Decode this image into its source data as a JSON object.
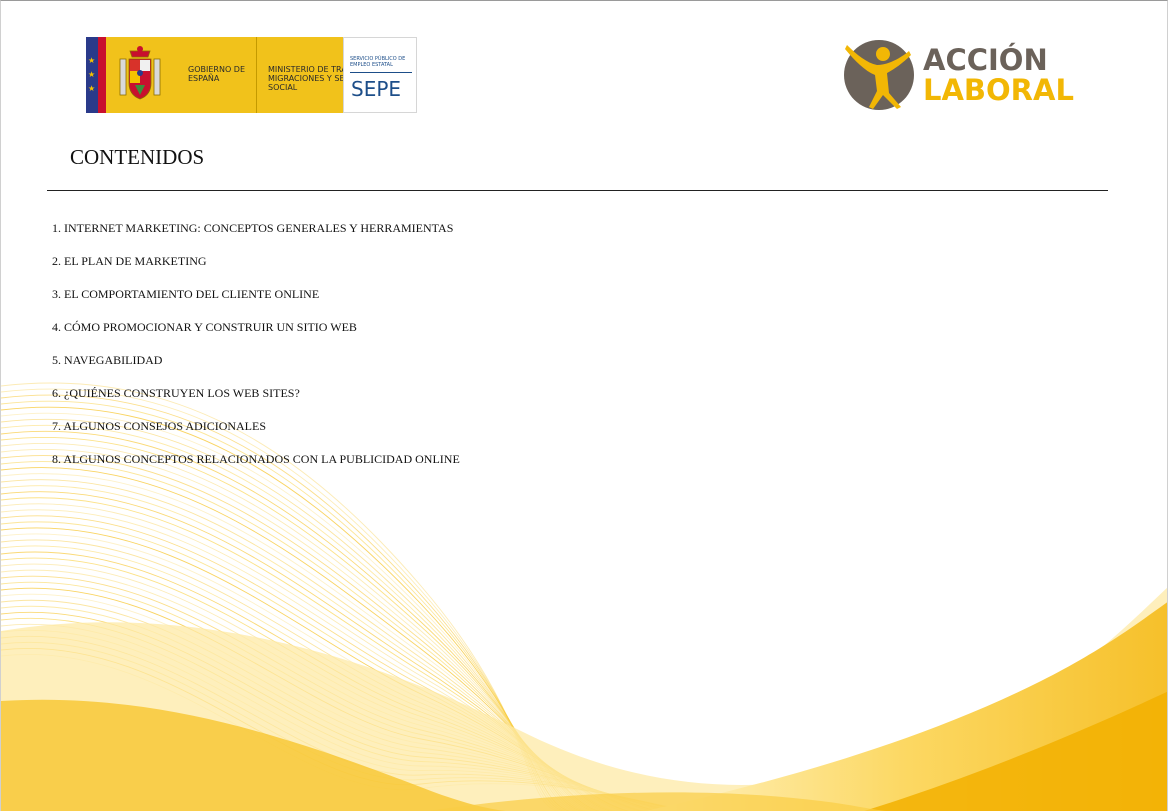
{
  "header": {
    "government": {
      "gobierno_label": "GOBIERNO DE ESPAÑA",
      "ministry_label": "MINISTERIO DE TRABAJO, MIGRACIONES Y SEGURIDAD SOCIAL",
      "sepe_subtitle": "SERVICIO PÚBLICO DE EMPLEO ESTATAL",
      "sepe_acronym": "SEPE",
      "colors": {
        "flag_blue": "#2a3a8a",
        "flag_red": "#c8102e",
        "yellow": "#f1c21b",
        "sepe_blue": "#1d4e89"
      }
    },
    "accion_laboral": {
      "word1": "ACCIÓN",
      "word2": "LABORAL",
      "colors": {
        "grey": "#6b625a",
        "yellow": "#f2b705"
      }
    }
  },
  "main": {
    "title": "CONTENIDOS",
    "toc": [
      "1. INTERNET MARKETING: CONCEPTOS GENERALES Y HERRAMIENTAS",
      "2. EL PLAN DE MARKETING",
      "3. EL COMPORTAMIENTO DEL CLIENTE ONLINE",
      "4. CÓMO PROMOCIONAR Y CONSTRUIR UN SITIO WEB",
      "5. NAVEGABILIDAD",
      "6. ¿QUIÉNES CONSTRUYEN LOS WEB SITES?",
      "7. ALGUNOS CONSEJOS ADICIONALES",
      "8. ALGUNOS CONCEPTOS RELACIONADOS CON LA PUBLICIDAD ONLINE"
    ]
  },
  "background": {
    "wave_colors": [
      "#f7c52e",
      "#fbd862",
      "#fde9a6",
      "#f4b400"
    ]
  }
}
